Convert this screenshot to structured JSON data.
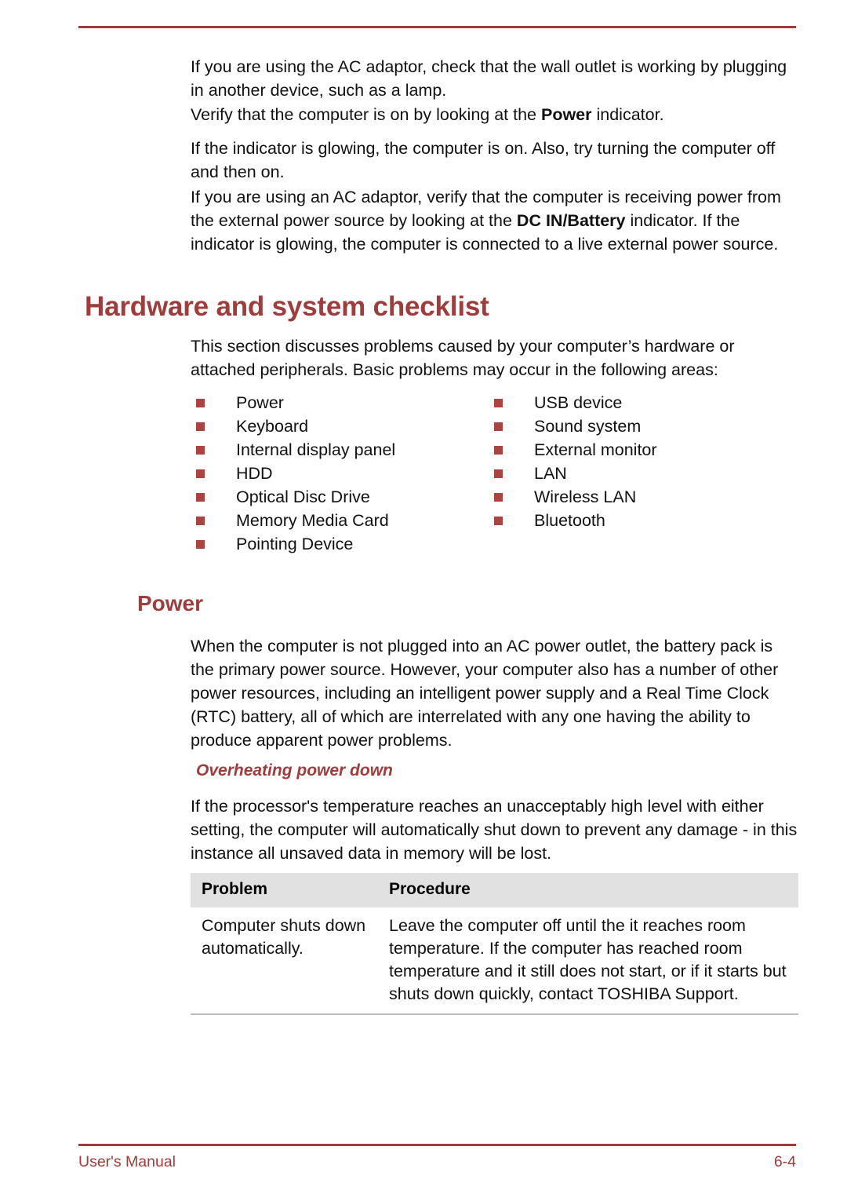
{
  "document": {
    "accent_color": "#a03c3c",
    "bullet_color": "#a94442",
    "table_header_bg": "#e1e1e1"
  },
  "body": {
    "paragraphs": [
      {
        "id": "p-ac-adaptor-wall-outlet",
        "runs": [
          {
            "text": "If you are using the AC adaptor, check that the wall outlet is working by plugging in another device, such as a lamp.",
            "bold": false
          }
        ]
      },
      {
        "id": "p-verify-power-indicator",
        "runs": [
          {
            "text": "Verify that the computer is on by looking at the ",
            "bold": false
          },
          {
            "text": "Power",
            "bold": true
          },
          {
            "text": " indicator.",
            "bold": false
          }
        ]
      },
      {
        "id": "p-indicator-glowing",
        "runs": [
          {
            "text": "If the indicator is glowing, the computer is on. Also, try turning the computer off and then on.",
            "bold": false
          }
        ]
      },
      {
        "id": "p-dc-in-battery",
        "runs": [
          {
            "text": "If you are using an AC adaptor, verify that the computer is receiving power from the external power source by looking at the ",
            "bold": false
          },
          {
            "text": "DC IN/Battery",
            "bold": true
          },
          {
            "text": " indicator. If the indicator is glowing, the computer is connected to a live external power source.",
            "bold": false
          }
        ]
      }
    ]
  },
  "section": {
    "heading": "Hardware and system checklist",
    "intro": "This section discusses problems caused by your computer’s hardware or attached peripherals. Basic problems may occur in the following areas:",
    "checklist": {
      "left_column": [
        "Power",
        "Keyboard",
        "Internal display panel",
        "HDD",
        "Optical Disc Drive",
        "Memory Media Card",
        "Pointing Device"
      ],
      "right_column": [
        "USB device",
        "Sound system",
        "External monitor",
        "LAN",
        "Wireless LAN",
        "Bluetooth"
      ]
    }
  },
  "power_section": {
    "heading": "Power",
    "paragraph": "When the computer is not plugged into an AC power outlet, the battery pack is the primary power source. However, your computer also has a number of other power resources, including an intelligent power supply and a Real Time Clock (RTC) battery, all of which are interrelated with any one having the ability to produce apparent power problems.",
    "subheading": "Overheating power down",
    "sub_paragraph": "If the processor's temperature reaches an unacceptably high level with either setting, the computer will automatically shut down to prevent any damage - in this instance all unsaved data in memory will be lost.",
    "table": {
      "headers": [
        "Problem",
        "Procedure"
      ],
      "rows": [
        {
          "problem": "Computer shuts down automatically.",
          "procedure": "Leave the computer off until the it reaches room temperature. If the computer has reached room temperature and it still does not start, or if it starts but shuts down quickly, contact TOSHIBA Support."
        }
      ]
    }
  },
  "footer": {
    "left": "User's Manual",
    "right": "6-4"
  }
}
